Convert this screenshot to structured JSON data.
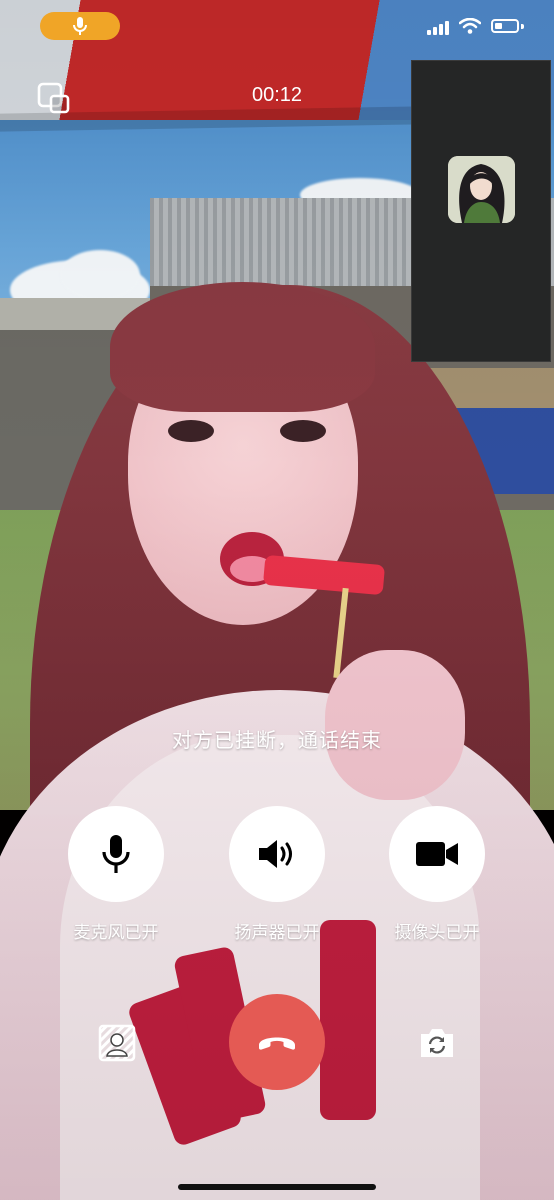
{
  "status_bar": {
    "mic_indicator_icon": "microphone-icon",
    "mic_indicator_color": "#f0a527"
  },
  "call": {
    "timer": "00:12",
    "status_message": "对方已挂断，通话结束"
  },
  "controls": {
    "mic": {
      "icon": "microphone-icon",
      "label": "麦克风已开"
    },
    "speaker": {
      "icon": "speaker-icon",
      "label": "扬声器已开"
    },
    "camera": {
      "icon": "video-camera-icon",
      "label": "摄像头已开"
    }
  },
  "bottom": {
    "blur_icon": "background-blur-icon",
    "hangup_icon": "hang-up-icon",
    "flip_icon": "flip-camera-icon"
  },
  "colors": {
    "hangup": "#e45a54",
    "button_bg": "#ffffff"
  }
}
